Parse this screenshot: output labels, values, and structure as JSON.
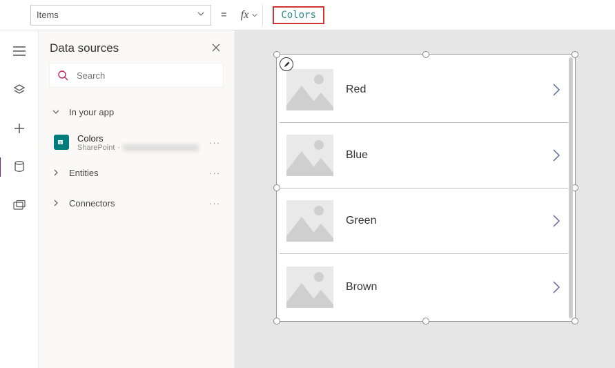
{
  "topbar": {
    "property": "Items",
    "formula": "Colors"
  },
  "panel": {
    "title": "Data sources",
    "search_placeholder": "Search",
    "sections": {
      "in_app": "In your app",
      "entities": "Entities",
      "connectors": "Connectors"
    },
    "datasource": {
      "name": "Colors",
      "provider": "SharePoint"
    }
  },
  "gallery": {
    "items": [
      {
        "title": "Red"
      },
      {
        "title": "Blue"
      },
      {
        "title": "Green"
      },
      {
        "title": "Brown"
      }
    ]
  }
}
